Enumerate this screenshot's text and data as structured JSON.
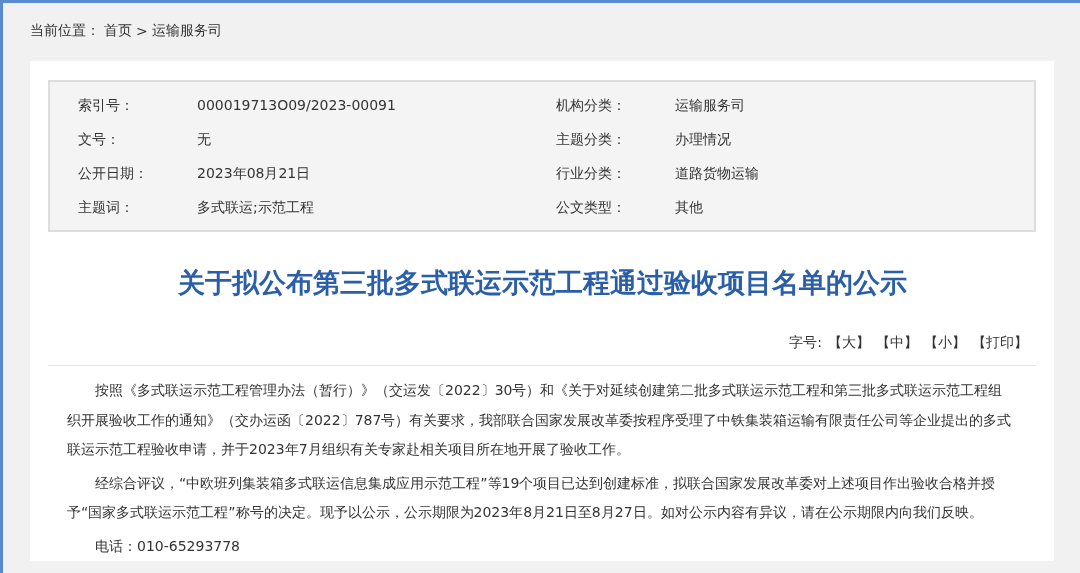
{
  "breadcrumb": {
    "label": "当前位置：",
    "items": [
      {
        "text": "首页"
      },
      {
        "text": "运输服务司"
      }
    ],
    "separator": ">"
  },
  "meta": [
    {
      "label": "索引号：",
      "value": "000019713O09/2023-00091"
    },
    {
      "label": "机构分类：",
      "value": "运输服务司"
    },
    {
      "label": "文号：",
      "value": "无"
    },
    {
      "label": "主题分类：",
      "value": "办理情况"
    },
    {
      "label": "公开日期：",
      "value": "2023年08月21日"
    },
    {
      "label": "行业分类：",
      "value": "道路货物运输"
    },
    {
      "label": "主题词：",
      "value": "多式联运;示范工程"
    },
    {
      "label": "公文类型：",
      "value": "其他"
    }
  ],
  "title": "关于拟公布第三批多式联运示范工程通过验收项目名单的公示",
  "font_tools": {
    "label": "字号:",
    "links": [
      "【大】",
      "【中】",
      "【小】",
      "【打印】"
    ]
  },
  "paragraphs": [
    "按照《多式联运示范工程管理办法（暂行）》（交运发〔2022〕30号）和《关于对延续创建第二批多式联运示范工程和第三批多式联运示范工程组织开展验收工作的通知》（交办运函〔2022〕787号）有关要求，我部联合国家发展改革委按程序受理了中铁集装箱运输有限责任公司等企业提出的多式联运示范工程验收申请，并于2023年7月组织有关专家赴相关项目所在地开展了验收工作。",
    "经综合评议，“中欧班列集装箱多式联运信息集成应用示范工程”等19个项目已达到创建标准，拟联合国家发展改革委对上述项目作出验收合格并授予“国家多式联运示范工程”称号的决定。现予以公示，公示期限为2023年8月21日至8月27日。如对公示内容有异议，请在公示期限内向我们反映。",
    "电话：010-65293778"
  ]
}
